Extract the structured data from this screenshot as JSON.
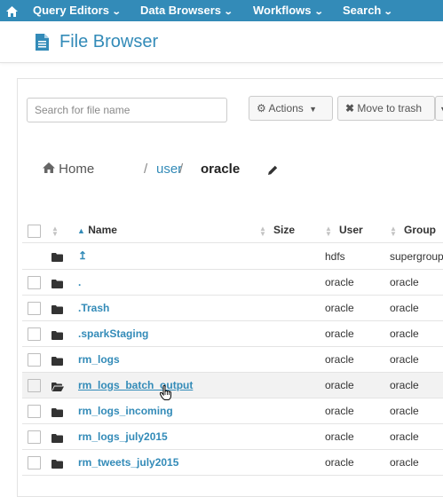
{
  "topnav": {
    "items": [
      {
        "label": "Query Editors"
      },
      {
        "label": "Data Browsers"
      },
      {
        "label": "Workflows"
      },
      {
        "label": "Search"
      }
    ]
  },
  "header": {
    "title": "File Browser"
  },
  "toolbar": {
    "search_placeholder": "Search for file name",
    "actions_label": "Actions",
    "move_to_trash_label": "Move to trash"
  },
  "breadcrumb": {
    "home": "Home",
    "sep1": "/",
    "part1": "user",
    "sep2": "/",
    "current": "oracle"
  },
  "table": {
    "columns": {
      "name": "Name",
      "size": "Size",
      "user": "User",
      "group": "Group"
    },
    "rows": [
      {
        "name": "↥",
        "user": "hdfs",
        "group": "supergroup"
      },
      {
        "name": ".",
        "user": "oracle",
        "group": "oracle"
      },
      {
        "name": ".Trash",
        "user": "oracle",
        "group": "oracle"
      },
      {
        "name": ".sparkStaging",
        "user": "oracle",
        "group": "oracle"
      },
      {
        "name": "rm_logs",
        "user": "oracle",
        "group": "oracle"
      },
      {
        "name": "rm_logs_batch_output",
        "user": "oracle",
        "group": "oracle"
      },
      {
        "name": "rm_logs_incoming",
        "user": "oracle",
        "group": "oracle"
      },
      {
        "name": "rm_logs_july2015",
        "user": "oracle",
        "group": "oracle"
      },
      {
        "name": "rm_tweets_july2015",
        "user": "oracle",
        "group": "oracle"
      }
    ]
  },
  "colors": {
    "brand_blue": "#338bb8",
    "row_hover": "#f2f2f2"
  }
}
